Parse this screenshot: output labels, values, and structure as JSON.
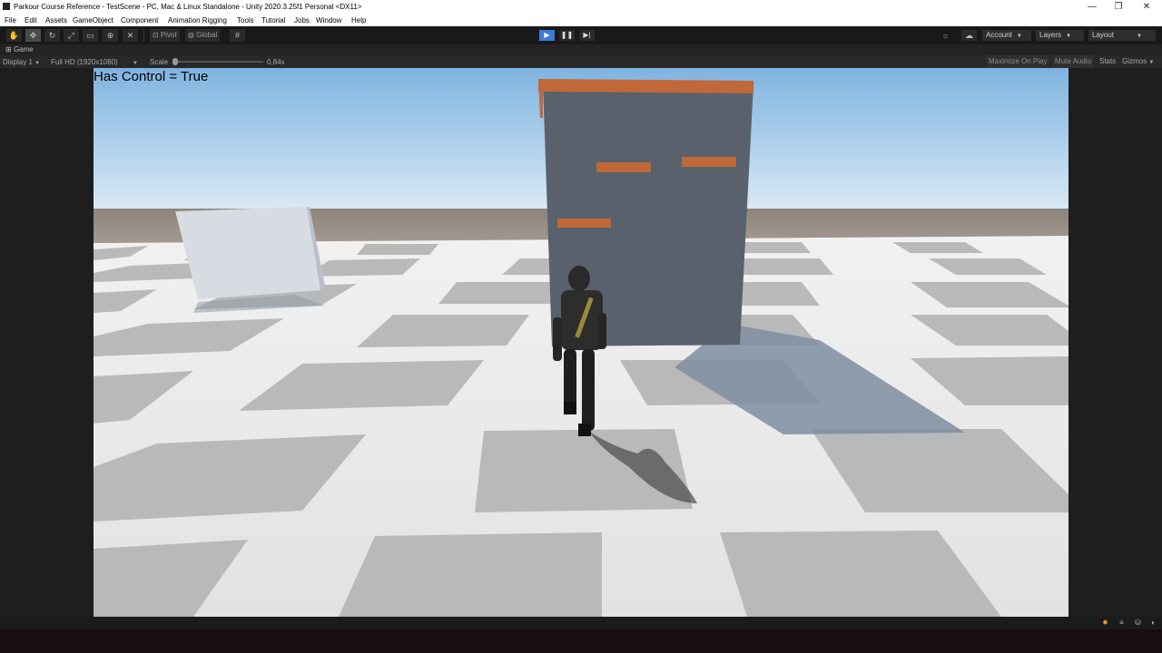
{
  "window": {
    "title": "Parkour Course Reference - TestScene - PC, Mac & Linux Standalone - Unity 2020.3.25f1 Personal <DX11>",
    "minimize": "—",
    "restore": "❐",
    "close": "✕"
  },
  "menu": {
    "items": [
      "File",
      "Edit",
      "Assets",
      "GameObject",
      "Component",
      "Animation Rigging",
      "Tools",
      "Tutorial",
      "Jobs",
      "Window",
      "Help"
    ]
  },
  "toolbar": {
    "tools": [
      "hand-tool-icon",
      "move-tool-icon",
      "rotate-tool-icon",
      "scale-tool-icon",
      "rect-tool-icon",
      "transform-tool-icon",
      "custom-tool-icon"
    ],
    "pivot_label": "Pivot",
    "global_label": "Global",
    "account_label": "Account",
    "layers_label": "Layers",
    "layout_label": "Layout"
  },
  "game_tab": {
    "label": "Game"
  },
  "game_bar": {
    "display": "Display 1",
    "resolution": "Full HD (1920x1080)",
    "scale_label": "Scale",
    "scale_value": "0.84x",
    "maximize_on_play": "Maximize On Play",
    "mute_audio": "Mute Audio",
    "stats": "Stats",
    "gizmos": "Gizmos"
  },
  "hud": {
    "text": "Has Control = True"
  },
  "colors": {
    "play_active": "#3a7bd5",
    "sky_top": "#7fb3e0",
    "wall": "#58616c",
    "ledge": "#c0683a"
  }
}
